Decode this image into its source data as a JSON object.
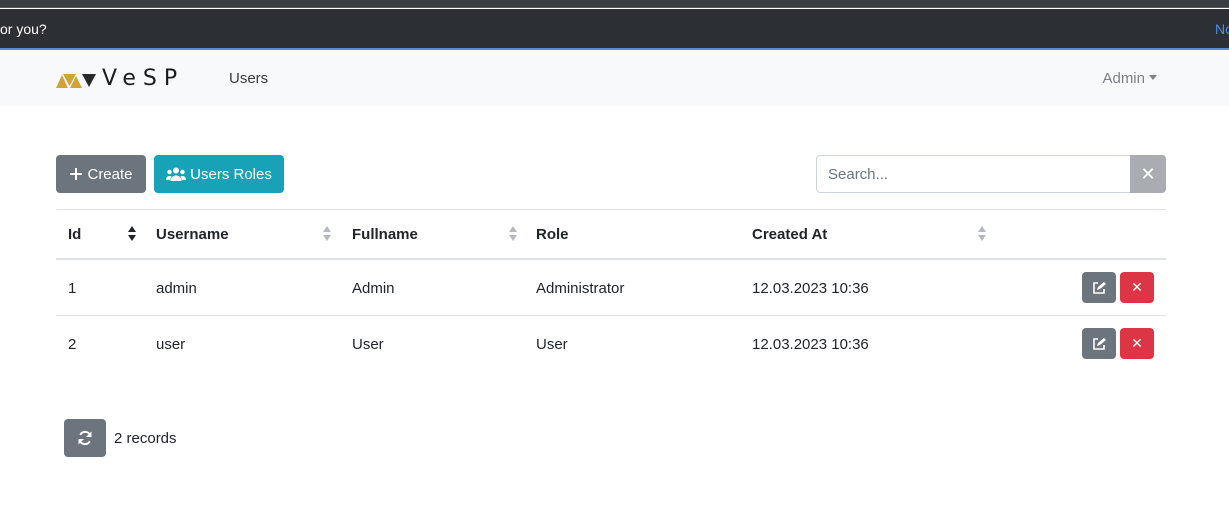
{
  "browser_bar": {
    "message": "or you?",
    "link_text": "No"
  },
  "navbar": {
    "brand": "VESP",
    "wordmark_display": "VeSP",
    "nav_users": "Users",
    "user_menu": "Admin",
    "colors": {
      "logo_gold": "#d4a237",
      "logo_dark": "#2a2a2a"
    }
  },
  "toolbar": {
    "create_label": "Create",
    "roles_label": "Users Roles",
    "search_placeholder": "Search...",
    "clear_symbol": "✕",
    "colors": {
      "create": "#6c757d",
      "roles": "#17a2b8"
    }
  },
  "table": {
    "columns": [
      {
        "label": "Id",
        "sortable": true,
        "sorted": true
      },
      {
        "label": "Username",
        "sortable": true,
        "sorted": false
      },
      {
        "label": "Fullname",
        "sortable": true,
        "sorted": false
      },
      {
        "label": "Role",
        "sortable": false,
        "sorted": false
      },
      {
        "label": "Created At",
        "sortable": true,
        "sorted": false
      }
    ],
    "rows": [
      {
        "id": "1",
        "username": "admin",
        "fullname": "Admin",
        "role": "Administrator",
        "created_at": "12.03.2023 10:36"
      },
      {
        "id": "2",
        "username": "user",
        "fullname": "User",
        "role": "User",
        "created_at": "12.03.2023 10:36"
      }
    ],
    "actions": {
      "edit_icon": "edit-icon",
      "delete_symbol": "✕",
      "colors": {
        "edit": "#6c757d",
        "delete": "#dc3545"
      }
    }
  },
  "footer": {
    "records_text": "2 records",
    "refresh_icon": "refresh-icon"
  }
}
